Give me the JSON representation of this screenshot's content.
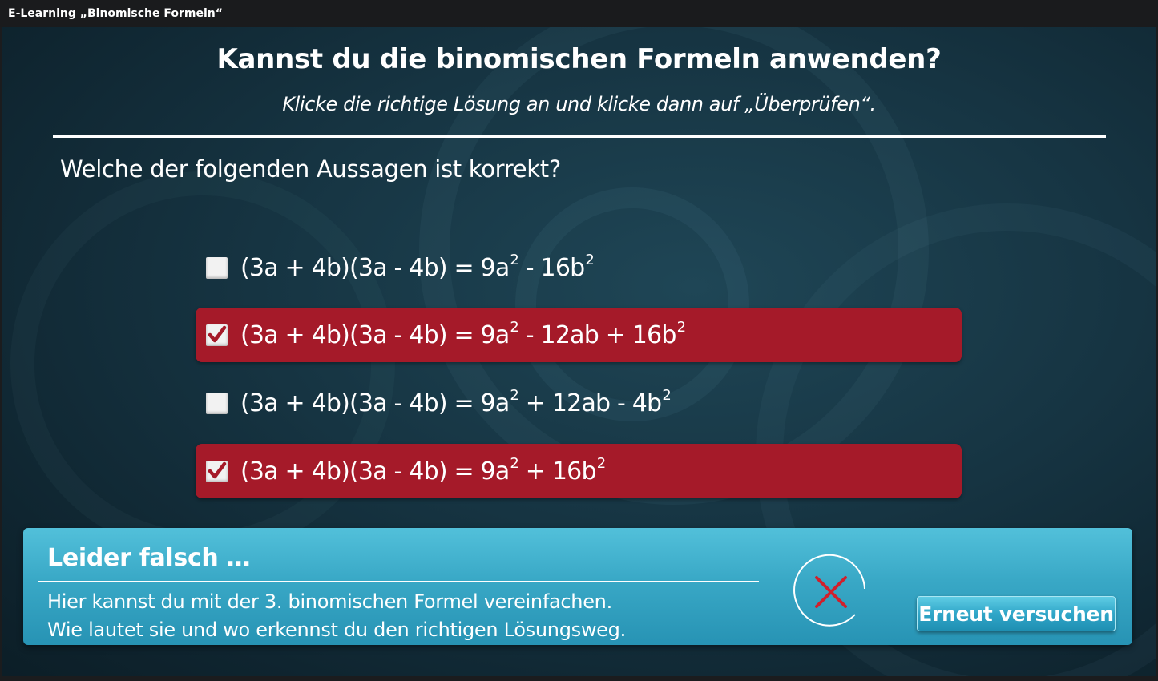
{
  "window": {
    "title": "E-Learning „Binomische Formeln“"
  },
  "header": {
    "title": "Kannst du die binomischen Formeln anwenden?",
    "subtitle": "Klicke die richtige Lösung an und klicke dann auf „Überprüfen“."
  },
  "question": "Welche der folgenden Aussagen ist korrekt?",
  "options": [
    {
      "lhs": "(3a + 4b)(3a - 4b) = 9a",
      "parts": [
        "(3a + 4b)(3a - 4b) = 9a",
        "2",
        " - 16b",
        "2"
      ],
      "checked": false,
      "highlighted": false
    },
    {
      "parts": [
        "(3a + 4b)(3a - 4b) = 9a",
        "2",
        " - 12ab + 16b",
        "2"
      ],
      "checked": true,
      "highlighted": true
    },
    {
      "parts": [
        "(3a + 4b)(3a - 4b) = 9a",
        "2",
        " + 12ab - 4b",
        "2"
      ],
      "checked": false,
      "highlighted": false
    },
    {
      "parts": [
        "(3a + 4b)(3a - 4b) = 9a",
        "2",
        " + 16b",
        "2"
      ],
      "checked": true,
      "highlighted": true
    }
  ],
  "feedback": {
    "title": "Leider falsch …",
    "lines": [
      "Hier kannst du mit der 3. binomischen Formel vereinfachen.",
      "Wie lautet sie und wo erkennst du den richtigen Lösungsweg."
    ],
    "icon": "x-mark-circle-icon",
    "retry_label": "Erneut versuchen"
  },
  "colors": {
    "selected_option": "#a51a29",
    "feedback_panel": "#39a8c6",
    "fail_icon": "#d0202c"
  }
}
